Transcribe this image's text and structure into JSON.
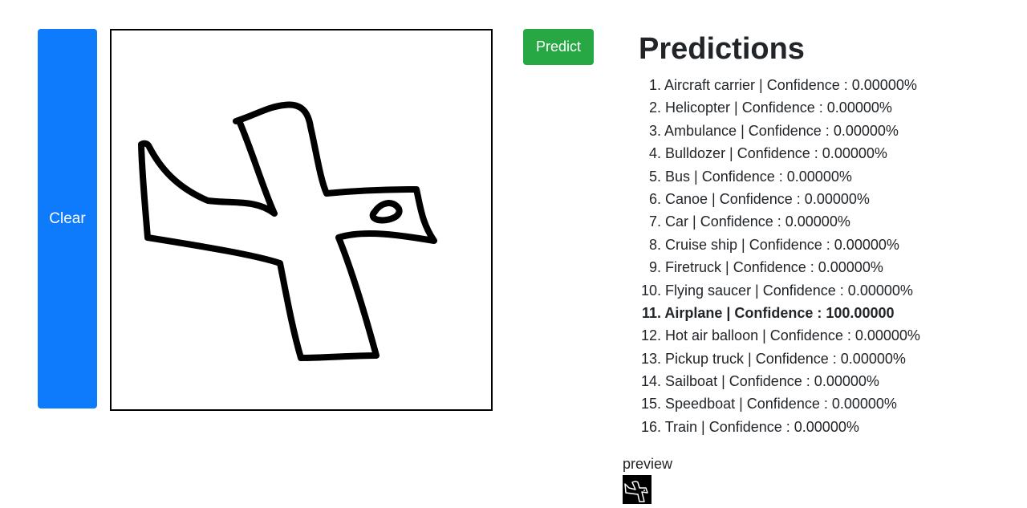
{
  "controls": {
    "clear_label": "Clear",
    "predict_label": "Predict"
  },
  "predictions": {
    "title": "Predictions",
    "items": [
      {
        "num": "1.",
        "text": "Aircraft carrier | Confidence : 0.00000%"
      },
      {
        "num": "2.",
        "text": "Helicopter | Confidence : 0.00000%"
      },
      {
        "num": "3.",
        "text": "Ambulance | Confidence : 0.00000%"
      },
      {
        "num": "4.",
        "text": "Bulldozer | Confidence : 0.00000%"
      },
      {
        "num": "5.",
        "text": "Bus | Confidence : 0.00000%"
      },
      {
        "num": "6.",
        "text": "Canoe | Confidence : 0.00000%"
      },
      {
        "num": "7.",
        "text": "Car | Confidence : 0.00000%"
      },
      {
        "num": "8.",
        "text": "Cruise ship | Confidence : 0.00000%"
      },
      {
        "num": "9.",
        "text": "Firetruck | Confidence : 0.00000%"
      },
      {
        "num": "10.",
        "text": "Flying saucer | Confidence : 0.00000%"
      },
      {
        "num": "11.",
        "text": "Airplane | Confidence : 100.00000"
      },
      {
        "num": "12.",
        "text": "Hot air balloon | Confidence : 0.00000%"
      },
      {
        "num": "13.",
        "text": "Pickup truck | Confidence : 0.00000%"
      },
      {
        "num": "14.",
        "text": "Sailboat | Confidence : 0.00000%"
      },
      {
        "num": "15.",
        "text": "Speedboat | Confidence : 0.00000%"
      },
      {
        "num": "16.",
        "text": "Train | Confidence : 0.00000%"
      }
    ]
  },
  "preview": {
    "label": "preview"
  },
  "colors": {
    "clear_button": "#0d7bfb",
    "predict_button": "#28a745"
  }
}
